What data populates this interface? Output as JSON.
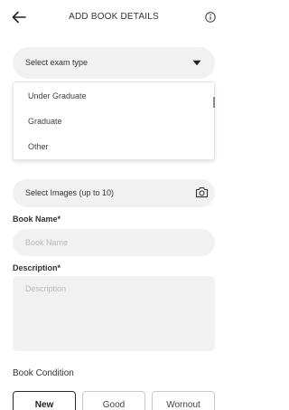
{
  "header": {
    "title": "ADD BOOK DETAILS",
    "back_icon": "arrow-left-icon",
    "info_icon": "info-circle-icon"
  },
  "exam_type": {
    "label": "Select exam type",
    "icon": "caret-down-icon",
    "options": [
      "Under Graduate",
      "Graduate",
      "Other"
    ]
  },
  "images": {
    "label": "Select Images (up to 10)",
    "icon": "camera-icon"
  },
  "book_name": {
    "label": "Book Name*",
    "placeholder": "Book Name",
    "value": ""
  },
  "description": {
    "label": "Description*",
    "placeholder": "Description",
    "value": ""
  },
  "condition": {
    "title": "Book Condition",
    "options": [
      "New",
      "Good",
      "Wornout"
    ],
    "selected": "New"
  },
  "colors": {
    "field_background": "#f1f1f1",
    "placeholder": "#b9b9b9",
    "text": "#333333",
    "selected_border": "#2a2a2a"
  }
}
